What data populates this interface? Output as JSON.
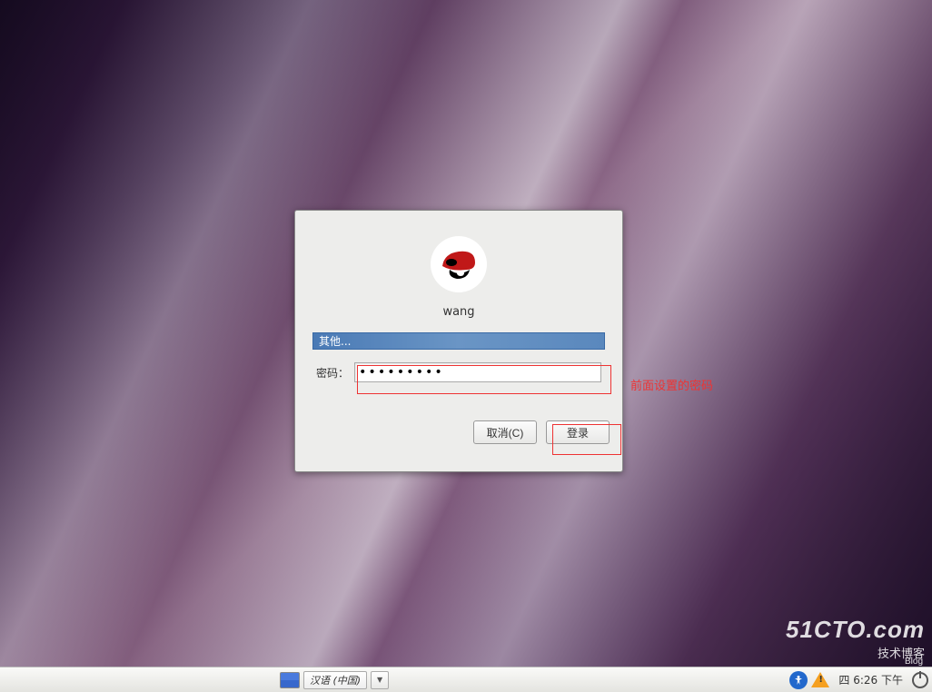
{
  "login": {
    "username": "wang",
    "other_label": "其他...",
    "password_label": "密码：",
    "password_value": "•••••••••",
    "cancel_label": "取消(C)",
    "login_label": "登录"
  },
  "annotations": {
    "password_hint": "前面设置的密码"
  },
  "taskbar": {
    "language": "汉语 (中国)",
    "clock": "四  6:26 下午"
  },
  "watermark": {
    "line1": "51CTO.com",
    "line2": "技术博客",
    "line3": "Blog"
  }
}
